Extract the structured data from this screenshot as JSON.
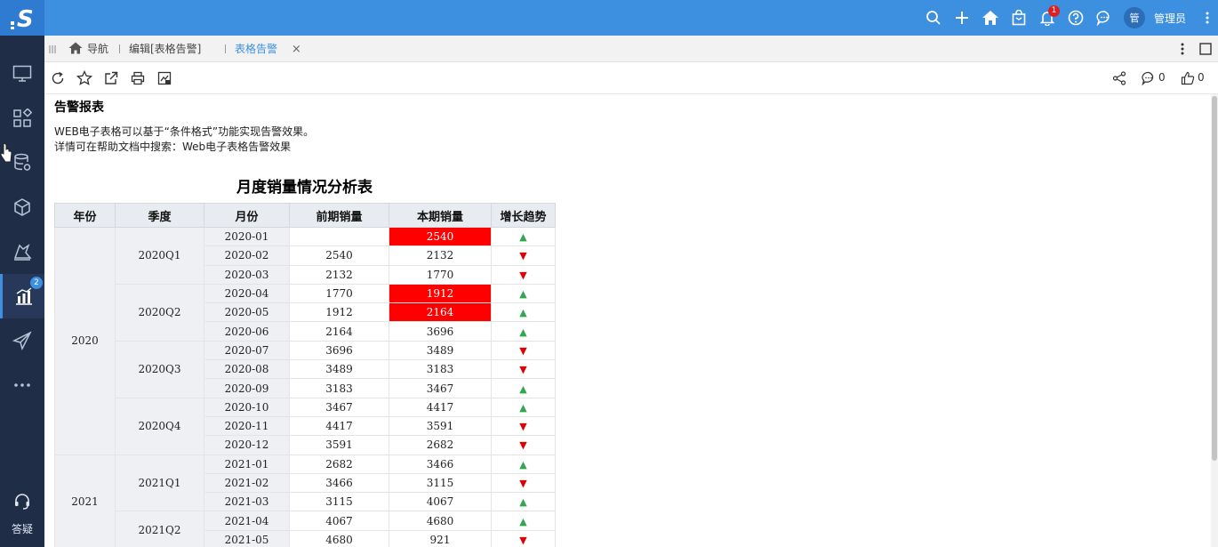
{
  "app": {
    "logo": "S"
  },
  "topbar": {
    "user_initial": "管",
    "username": "管理员",
    "notification_count": "1"
  },
  "sidebar": {
    "items": [
      {
        "name": "monitor-icon"
      },
      {
        "name": "apps-icon"
      },
      {
        "name": "database-settings-icon"
      },
      {
        "name": "cube-icon"
      },
      {
        "name": "paint-icon"
      },
      {
        "name": "chart-icon",
        "badge": "2"
      },
      {
        "name": "send-icon"
      },
      {
        "name": "more-icon"
      }
    ],
    "help_label": "答疑"
  },
  "tabs": [
    {
      "label": "导航"
    },
    {
      "label": "编辑[表格告警]"
    },
    {
      "label": "表格告警",
      "active": true
    }
  ],
  "toolbar": {
    "comment_count": "0",
    "like_count": "0"
  },
  "report": {
    "title": "告警报表",
    "desc_line1": "WEB电子表格可以基于“条件格式”功能实现告警效果。",
    "desc_line2": "详情可在帮助文档中搜索：Web电子表格告警效果",
    "table_title": "月度销量情况分析表",
    "columns": [
      "年份",
      "季度",
      "月份",
      "前期销量",
      "本期销量",
      "增长趋势"
    ],
    "years": [
      {
        "label": "2020",
        "rows": 12
      },
      {
        "label": "2021",
        "rows": 5
      }
    ],
    "quarters": [
      {
        "label": "2020Q1",
        "rows": 3
      },
      {
        "label": "2020Q2",
        "rows": 3
      },
      {
        "label": "2020Q3",
        "rows": 3
      },
      {
        "label": "2020Q4",
        "rows": 3
      },
      {
        "label": "2021Q1",
        "rows": 3
      },
      {
        "label": "2021Q2",
        "rows": 2
      }
    ],
    "rows": [
      {
        "month": "2020-01",
        "prev": "",
        "curr": "2540",
        "trend": "up",
        "alert": true
      },
      {
        "month": "2020-02",
        "prev": "2540",
        "curr": "2132",
        "trend": "down",
        "alert": false
      },
      {
        "month": "2020-03",
        "prev": "2132",
        "curr": "1770",
        "trend": "down",
        "alert": false
      },
      {
        "month": "2020-04",
        "prev": "1770",
        "curr": "1912",
        "trend": "up",
        "alert": true
      },
      {
        "month": "2020-05",
        "prev": "1912",
        "curr": "2164",
        "trend": "up",
        "alert": true
      },
      {
        "month": "2020-06",
        "prev": "2164",
        "curr": "3696",
        "trend": "up",
        "alert": false
      },
      {
        "month": "2020-07",
        "prev": "3696",
        "curr": "3489",
        "trend": "down",
        "alert": false
      },
      {
        "month": "2020-08",
        "prev": "3489",
        "curr": "3183",
        "trend": "down",
        "alert": false
      },
      {
        "month": "2020-09",
        "prev": "3183",
        "curr": "3467",
        "trend": "up",
        "alert": false
      },
      {
        "month": "2020-10",
        "prev": "3467",
        "curr": "4417",
        "trend": "up",
        "alert": false
      },
      {
        "month": "2020-11",
        "prev": "4417",
        "curr": "3591",
        "trend": "down",
        "alert": false
      },
      {
        "month": "2020-12",
        "prev": "3591",
        "curr": "2682",
        "trend": "down",
        "alert": false
      },
      {
        "month": "2021-01",
        "prev": "2682",
        "curr": "3466",
        "trend": "up",
        "alert": false
      },
      {
        "month": "2021-02",
        "prev": "3466",
        "curr": "3115",
        "trend": "down",
        "alert": false
      },
      {
        "month": "2021-03",
        "prev": "3115",
        "curr": "4067",
        "trend": "up",
        "alert": false
      },
      {
        "month": "2021-04",
        "prev": "4067",
        "curr": "4680",
        "trend": "up",
        "alert": false
      },
      {
        "month": "2021-05",
        "prev": "4680",
        "curr": "921",
        "trend": "down",
        "alert": false
      }
    ]
  },
  "colors": {
    "topbar": "#3d8fe0",
    "sidebar": "#1f2d47",
    "alert": "#ff0000",
    "up": "#2fa84f",
    "down": "#e00000",
    "accent": "#3d8fe0"
  }
}
